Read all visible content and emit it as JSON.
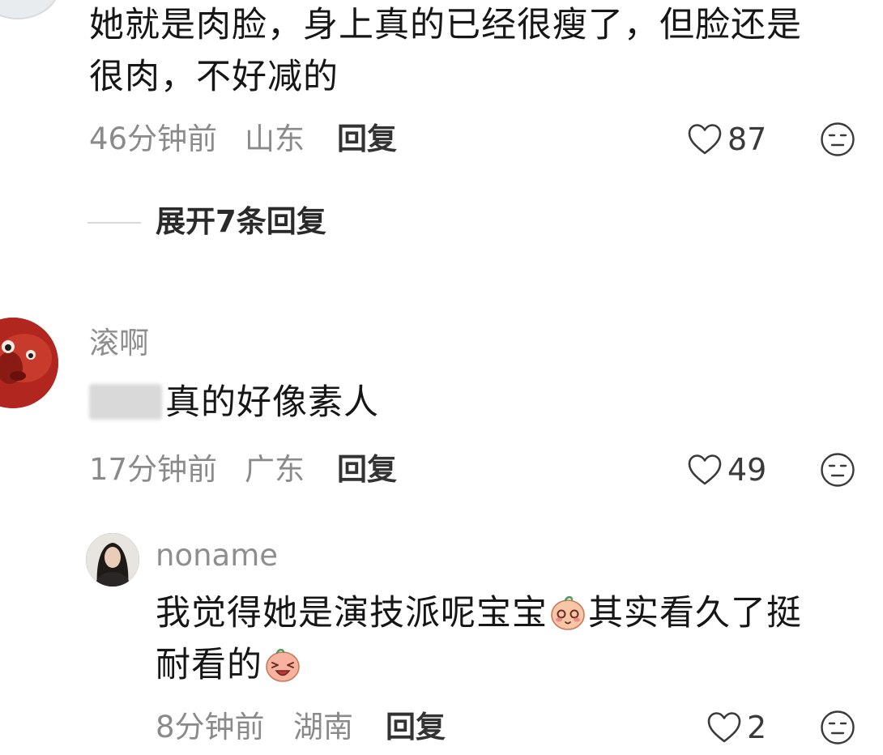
{
  "comments": [
    {
      "text_line1": "她就是肉脸，身上真的已经很瘦了，但脸还是",
      "text_line2": "很肉，不好减的",
      "time": "46分钟前",
      "location": "山东",
      "reply_label": "回复",
      "likes": "87",
      "expand_label": "展开7条回复"
    },
    {
      "username": "滚啊",
      "text": "真的好像素人",
      "time": "17分钟前",
      "location": "广东",
      "reply_label": "回复",
      "likes": "49"
    },
    {
      "username": "noname",
      "text_line1_a": "我觉得她是演技派呢宝宝",
      "text_line1_b": "其实看久了挺",
      "text_line2": "耐看的",
      "time": "8分钟前",
      "location": "湖南",
      "reply_label": "回复",
      "likes": "2"
    }
  ],
  "icons": {
    "like": "heart-outline-icon",
    "dislike": "neutral-face-icon",
    "emoji_shy": "shy-face-emoji",
    "emoji_laugh": "laugh-face-emoji"
  },
  "colors": {
    "text": "#161616",
    "meta": "#8a8a8a",
    "accent_avatar": "#b1271f"
  }
}
